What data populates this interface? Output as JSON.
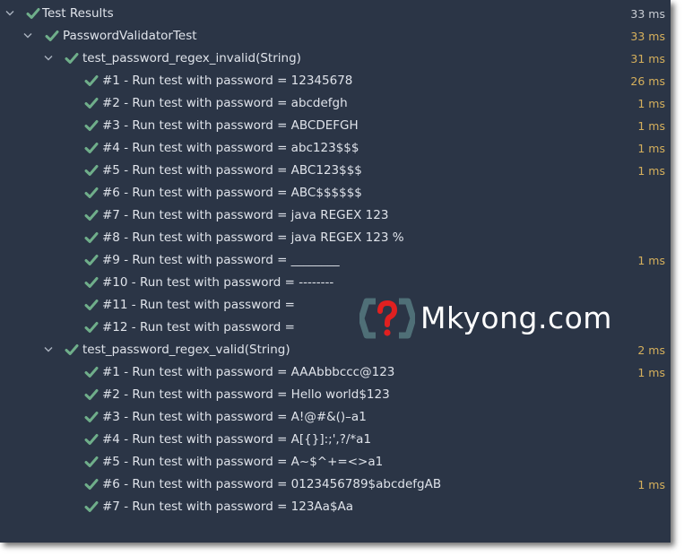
{
  "rows": [
    {
      "label": "Test Results",
      "time": "33 ms",
      "time_style": "muted",
      "level": 0,
      "expandable": true
    },
    {
      "label": "PasswordValidatorTest",
      "time": "33 ms",
      "time_style": "warn",
      "level": 1,
      "expandable": true
    },
    {
      "label": "test_password_regex_invalid(String)",
      "time": "31 ms",
      "time_style": "warn",
      "level": 2,
      "expandable": true
    },
    {
      "label": "#1 - Run test with password = 12345678",
      "time": "26 ms",
      "time_style": "warn",
      "level": 3,
      "expandable": false
    },
    {
      "label": "#2 - Run test with password = abcdefgh",
      "time": "1 ms",
      "time_style": "warn",
      "level": 3,
      "expandable": false
    },
    {
      "label": "#3 - Run test with password = ABCDEFGH",
      "time": "1 ms",
      "time_style": "warn",
      "level": 3,
      "expandable": false
    },
    {
      "label": "#4 - Run test with password = abc123$$$",
      "time": "1 ms",
      "time_style": "warn",
      "level": 3,
      "expandable": false
    },
    {
      "label": "#5 - Run test with password = ABC123$$$",
      "time": "1 ms",
      "time_style": "warn",
      "level": 3,
      "expandable": false
    },
    {
      "label": "#6 - Run test with password = ABC$$$$$$",
      "time": "",
      "time_style": "warn",
      "level": 3,
      "expandable": false
    },
    {
      "label": "#7 - Run test with password = java REGEX 123",
      "time": "",
      "time_style": "warn",
      "level": 3,
      "expandable": false
    },
    {
      "label": "#8 - Run test with password = java REGEX 123 %",
      "time": "",
      "time_style": "warn",
      "level": 3,
      "expandable": false
    },
    {
      "label": "#9 - Run test with password = ________",
      "time": "1 ms",
      "time_style": "warn",
      "level": 3,
      "expandable": false
    },
    {
      "label": "#10 - Run test with password = --------",
      "time": "",
      "time_style": "warn",
      "level": 3,
      "expandable": false
    },
    {
      "label": "#11 - Run test with password =",
      "time": "",
      "time_style": "warn",
      "level": 3,
      "expandable": false
    },
    {
      "label": "#12 - Run test with password =",
      "time": "",
      "time_style": "warn",
      "level": 3,
      "expandable": false
    },
    {
      "label": "test_password_regex_valid(String)",
      "time": "2 ms",
      "time_style": "warn",
      "level": 2,
      "expandable": true
    },
    {
      "label": "#1 - Run test with password = AAAbbbccc@123",
      "time": "1 ms",
      "time_style": "warn",
      "level": 3,
      "expandable": false
    },
    {
      "label": "#2 - Run test with password = Hello world$123",
      "time": "",
      "time_style": "warn",
      "level": 3,
      "expandable": false
    },
    {
      "label": "#3 - Run test with password = A!@#&()–a1",
      "time": "",
      "time_style": "warn",
      "level": 3,
      "expandable": false
    },
    {
      "label": "#4 - Run test with password = A[{}]:;',?/*a1",
      "time": "",
      "time_style": "warn",
      "level": 3,
      "expandable": false
    },
    {
      "label": "#5 - Run test with password = A~$^+=<>a1",
      "time": "",
      "time_style": "warn",
      "level": 3,
      "expandable": false
    },
    {
      "label": "#6 - Run test with password = 0123456789$abcdefgAB",
      "time": "1 ms",
      "time_style": "warn",
      "level": 3,
      "expandable": false
    },
    {
      "label": "#7 - Run test with password = 123Aa$Aa",
      "time": "",
      "time_style": "warn",
      "level": 3,
      "expandable": false
    }
  ],
  "watermark": {
    "text": "Mkyong.com",
    "icon": "question-mark-braces-icon"
  },
  "icons": {
    "pass": "check-icon",
    "expanded": "chevron-down-icon"
  },
  "colors": {
    "background": "#2b3546",
    "pass": "#6fae8a",
    "time_warn": "#d6b05c",
    "text": "#dfe3ea",
    "watermark_logo": "#4f6f77",
    "watermark_mark": "#e02020"
  }
}
